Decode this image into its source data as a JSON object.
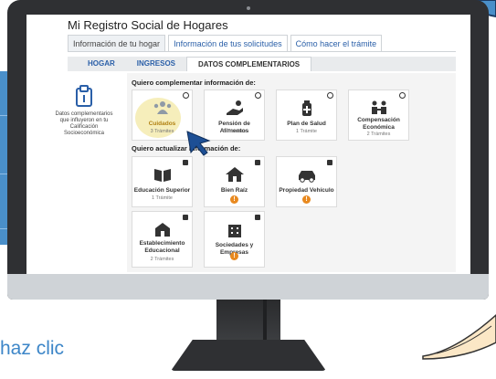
{
  "caption": "haz clic",
  "app": {
    "title": "Mi Registro Social de Hogares",
    "top_tabs": [
      {
        "label": "Información de tu hogar",
        "active": true
      },
      {
        "label": "Información de tus solicitudes",
        "active": false
      },
      {
        "label": "Cómo hacer el trámite",
        "active": false
      }
    ],
    "sub_tabs": [
      {
        "label": "HOGAR",
        "active": false
      },
      {
        "label": "INGRESOS",
        "active": false
      },
      {
        "label": "DATOS COMPLEMENTARIOS",
        "active": true
      }
    ],
    "sidebar": {
      "icon": "document-icon",
      "text": "Datos complementarios que influyeron en tu Calificación Socioeconómica"
    },
    "section_complement": "Quiero complementar información de:",
    "complement_cards": [
      {
        "title": "Cuidados",
        "sub": "3 Trámites",
        "icon": "people-icon",
        "highlighted": true
      },
      {
        "title": "Pensión de Alimentos",
        "sub": "3 Trámites",
        "icon": "hand-coin-icon"
      },
      {
        "title": "Plan de Salud",
        "sub": "1 Trámite",
        "icon": "health-kit-icon"
      },
      {
        "title": "Compensación Económica",
        "sub": "2 Trámites",
        "icon": "compensation-icon"
      }
    ],
    "section_update": "Quiero actualizar información de:",
    "update_cards": [
      {
        "title": "Educación Superior",
        "sub": "1 Trámite",
        "icon": "book-icon"
      },
      {
        "title": "Bien Raíz",
        "badge": "!",
        "icon": "house-icon"
      },
      {
        "title": "Propiedad Vehículo",
        "badge": "!",
        "icon": "car-icon"
      },
      {
        "title": "Establecimiento Educacional",
        "sub": "2 Trámites",
        "icon": "school-icon"
      },
      {
        "title": "Sociedades y Empresas",
        "badge": "!",
        "icon": "building-icon"
      }
    ],
    "colors": {
      "accent": "#2a5fa8",
      "highlight": "#f6eebb",
      "badge": "#e8891f",
      "caption": "#3d86c8"
    }
  }
}
